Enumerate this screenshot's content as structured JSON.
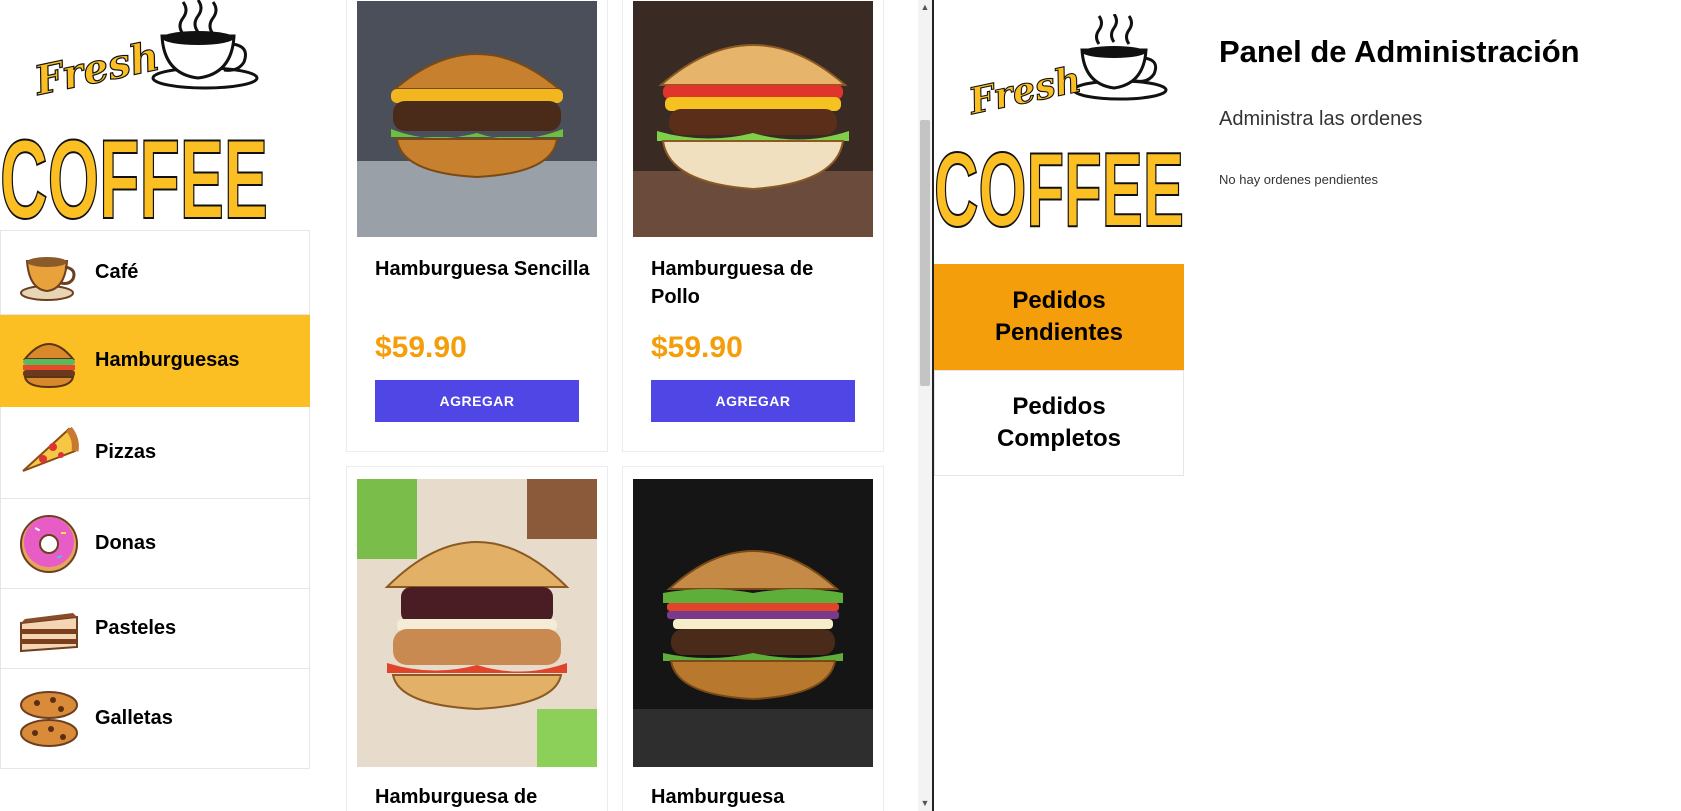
{
  "brand": {
    "logo_top": "Fresh",
    "logo_main": "COFFEE"
  },
  "categories": [
    {
      "label": "Café",
      "icon": "coffee-cup-icon",
      "active": false
    },
    {
      "label": "Hamburguesas",
      "icon": "burger-icon",
      "active": true
    },
    {
      "label": "Pizzas",
      "icon": "pizza-slice-icon",
      "active": false
    },
    {
      "label": "Donas",
      "icon": "donut-icon",
      "active": false
    },
    {
      "label": "Pasteles",
      "icon": "cake-slice-icon",
      "active": false
    },
    {
      "label": "Galletas",
      "icon": "cookies-icon",
      "active": false
    }
  ],
  "products": [
    {
      "name": "Hamburguesa Sencilla",
      "price": "$59.90",
      "button": "AGREGAR"
    },
    {
      "name": "Hamburguesa de Pollo",
      "price": "$59.90",
      "button": "AGREGAR"
    },
    {
      "name": "Hamburguesa de",
      "price": "",
      "button": ""
    },
    {
      "name": "Hamburguesa",
      "price": "",
      "button": ""
    }
  ],
  "admin": {
    "title": "Panel de Administración",
    "subtitle": "Administra las ordenes",
    "empty_message": "No hay ordenes pendientes",
    "nav": [
      {
        "label": "Pedidos Pendientes",
        "active": true
      },
      {
        "label": "Pedidos Completos",
        "active": false
      }
    ]
  },
  "colors": {
    "accent_yellow": "#fbbf24",
    "accent_orange": "#f59e0b",
    "button_indigo": "#4f46e5"
  }
}
